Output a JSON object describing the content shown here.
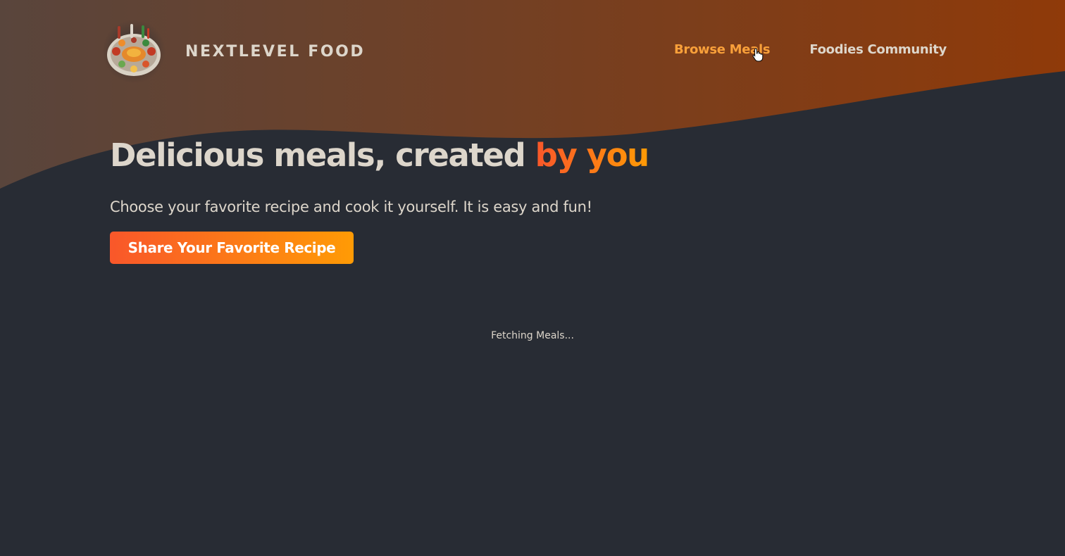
{
  "header": {
    "logo_alt": "A plate with food on it",
    "logo_text": "NEXTLEVEL FOOD",
    "nav": [
      {
        "label": "Browse Meals",
        "active": true
      },
      {
        "label": "Foodies Community",
        "active": false
      }
    ]
  },
  "hero": {
    "title_main": "Delicious meals, created ",
    "title_highlight": "by you",
    "subtitle": "Choose your favorite recipe and cook it yourself. It is easy and fun!",
    "cta_label": "Share Your Favorite Recipe"
  },
  "loading_text": "Fetching Meals...",
  "colors": {
    "background": "#282c34",
    "header_gradient_start": "#59453c",
    "header_gradient_end": "#8f3a09",
    "accent_start": "#f9572a",
    "accent_end": "#ff9b05",
    "text": "#ddd6cb",
    "nav_active": "#f9a03a"
  },
  "icons": {
    "logo": "food-plate-icon",
    "cursor": "hand-pointer-icon"
  }
}
